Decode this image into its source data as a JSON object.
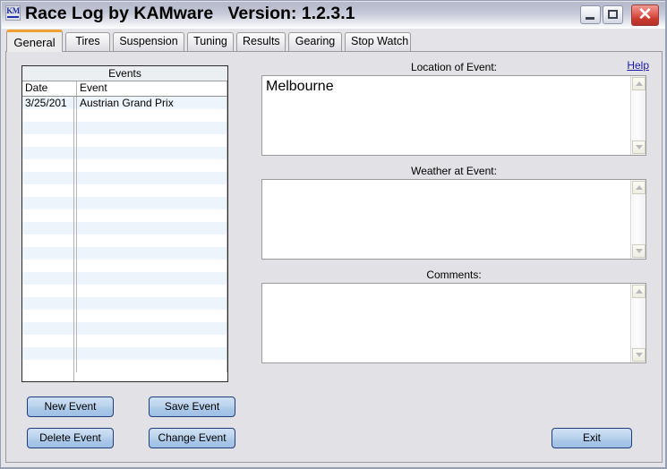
{
  "window": {
    "title": "Race Log by KAMware   Version: 1.2.3.1",
    "icon_text": "KM",
    "minimize_label": "_",
    "maximize_label": "",
    "close_label": "✕"
  },
  "tabs": [
    {
      "label": "General",
      "active": true
    },
    {
      "label": "Tires",
      "active": false
    },
    {
      "label": "Suspension",
      "active": false
    },
    {
      "label": "Tuning",
      "active": false
    },
    {
      "label": "Results",
      "active": false
    },
    {
      "label": "Gearing",
      "active": false
    },
    {
      "label": "Stop Watch",
      "active": false
    }
  ],
  "help": {
    "label": "Help"
  },
  "events_grid": {
    "caption": "Events",
    "columns": [
      "Date",
      "Event"
    ],
    "rows": [
      {
        "date": "3/25/201",
        "event": "Austrian Grand Prix"
      }
    ],
    "empty_row_count": 21
  },
  "fields": [
    {
      "label": "Location of Event:",
      "value": "Melbourne",
      "placeholder": ""
    },
    {
      "label": "Weather at Event:",
      "value": "",
      "placeholder": ""
    },
    {
      "label": "Comments:",
      "value": "",
      "placeholder": ""
    }
  ],
  "buttons": {
    "new_event": "New Event",
    "save_event": "Save Event",
    "delete_event": "Delete Event",
    "change_event": "Change Event",
    "exit": "Exit"
  },
  "colors": {
    "accent_tab": "#f0a030",
    "button_border": "#1f3d7a",
    "link": "#1a1aa8",
    "close_button": "#c93a2e",
    "panel_bg": "#e2e2e6",
    "row_alt": "#eef4fb"
  }
}
